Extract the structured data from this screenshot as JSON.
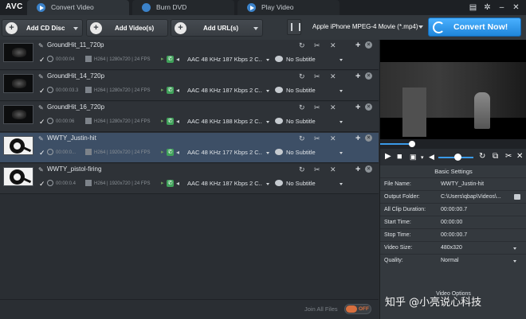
{
  "app": {
    "logo": "AVC"
  },
  "tabs": [
    {
      "label": "Convert Video",
      "active": true
    },
    {
      "label": "Burn DVD",
      "active": false
    },
    {
      "label": "Play Video",
      "active": false
    }
  ],
  "window_controls": {
    "cart": "cart-icon",
    "settings": "gear-icon",
    "minimize": "–",
    "close": "✕"
  },
  "toolbar": {
    "add_cd": "Add CD Disc",
    "add_video": "Add Video(s)",
    "add_url": "Add URL(s)",
    "output_format": "Apple iPhone MPEG-4 Movie (*.mp4)",
    "convert": "Convert Now!"
  },
  "files": [
    {
      "name": "GroundHit_11_720p",
      "duration": "00:00:04",
      "video": "H264 | 1280x720 | 24 FPS",
      "audio": "AAC 48 KHz 187 Kbps 2 C...",
      "subtitle": "No Subtitle",
      "thumb": "frame",
      "selected": false
    },
    {
      "name": "GroundHit_14_720p",
      "duration": "00:00:03.3",
      "video": "H264 | 1280x720 | 24 FPS",
      "audio": "AAC 48 KHz 187 Kbps 2 C...",
      "subtitle": "No Subtitle",
      "thumb": "frame",
      "selected": false
    },
    {
      "name": "GroundHit_16_720p",
      "duration": "00:00:06",
      "video": "H264 | 1280x720 | 24 FPS",
      "audio": "AAC 48 KHz 188 Kbps 2 C...",
      "subtitle": "No Subtitle",
      "thumb": "frame",
      "selected": false
    },
    {
      "name": "WWTY_Justin-hit",
      "duration": "00:00:0...",
      "video": "H264 | 1920x720 | 24 FPS",
      "audio": "AAC 48 KHz 177 Kbps 2 C...",
      "subtitle": "No Subtitle",
      "thumb": "reel",
      "selected": true
    },
    {
      "name": "WWTY_pistol-firing",
      "duration": "00:00:0.4",
      "video": "H264 | 1920x720 | 24 FPS",
      "audio": "AAC 48 KHz 187 Kbps 2 C...",
      "subtitle": "No Subtitle",
      "thumb": "reel",
      "selected": false
    }
  ],
  "bottom": {
    "join_label": "Join All Files",
    "toggle": "OFF"
  },
  "player": {
    "progress": 0.22,
    "volume": 0.55
  },
  "settings": {
    "heading": "Basic Settings",
    "rows": [
      {
        "key": "File Name:",
        "value": "WWTY_Justin-hit",
        "control": "none"
      },
      {
        "key": "Output Folder:",
        "value": "C:\\Users\\qbap\\Videos\\...",
        "control": "folder"
      },
      {
        "key": "All Clip Duration:",
        "value": "00:00:00.7",
        "control": "none"
      },
      {
        "key": "Start Time:",
        "value": "00:00:00",
        "control": "none"
      },
      {
        "key": "Stop Time:",
        "value": "00:00:00.7",
        "control": "none"
      },
      {
        "key": "Video Size:",
        "value": "480x320",
        "control": "dropdown"
      },
      {
        "key": "Quality:",
        "value": "Normal",
        "control": "dropdown"
      }
    ],
    "video_options": "Video Options"
  },
  "watermark": "知乎 @小亮说心科技"
}
